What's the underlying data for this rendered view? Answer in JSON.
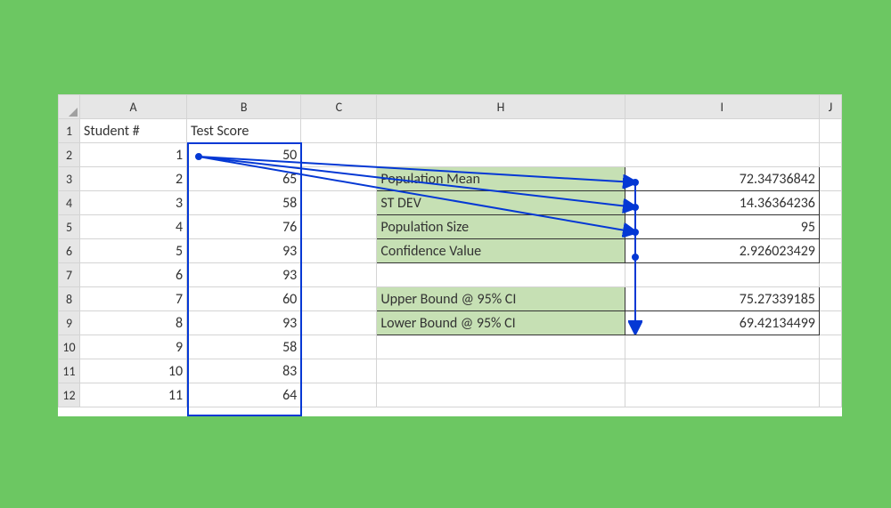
{
  "columns": {
    "A": "A",
    "B": "B",
    "C": "C",
    "H": "H",
    "I": "I",
    "J": "J"
  },
  "rowHeaders": [
    "1",
    "2",
    "3",
    "4",
    "5",
    "6",
    "7",
    "8",
    "9",
    "10",
    "11",
    "12"
  ],
  "headers": {
    "studentNum": "Student #",
    "testScore": "Test Score"
  },
  "students": [
    {
      "num": "1",
      "score": "50"
    },
    {
      "num": "2",
      "score": "65"
    },
    {
      "num": "3",
      "score": "58"
    },
    {
      "num": "4",
      "score": "76"
    },
    {
      "num": "5",
      "score": "93"
    },
    {
      "num": "6",
      "score": "93"
    },
    {
      "num": "7",
      "score": "60"
    },
    {
      "num": "8",
      "score": "93"
    },
    {
      "num": "9",
      "score": "58"
    },
    {
      "num": "10",
      "score": "83"
    },
    {
      "num": "11",
      "score": "64"
    }
  ],
  "stats": {
    "mean_label": "Population Mean",
    "mean_val": "72.34736842",
    "stdev_label": "ST DEV",
    "stdev_val": "14.36364236",
    "size_label": "Population Size",
    "size_val": "95",
    "conf_label": "Confidence Value",
    "conf_val": "2.926023429",
    "upper_label": "Upper Bound @ 95% CI",
    "upper_val": "75.27339185",
    "lower_label": "Lower Bound @ 95% CI",
    "lower_val": "69.42134499"
  },
  "chart_data": {
    "type": "table",
    "title": "Confidence interval statistics",
    "series": [
      {
        "name": "Population Mean",
        "values": [
          72.34736842
        ]
      },
      {
        "name": "ST DEV",
        "values": [
          14.36364236
        ]
      },
      {
        "name": "Population Size",
        "values": [
          95
        ]
      },
      {
        "name": "Confidence Value",
        "values": [
          2.926023429
        ]
      },
      {
        "name": "Upper Bound @ 95% CI",
        "values": [
          75.27339185
        ]
      },
      {
        "name": "Lower Bound @ 95% CI",
        "values": [
          69.42134499
        ]
      }
    ]
  }
}
